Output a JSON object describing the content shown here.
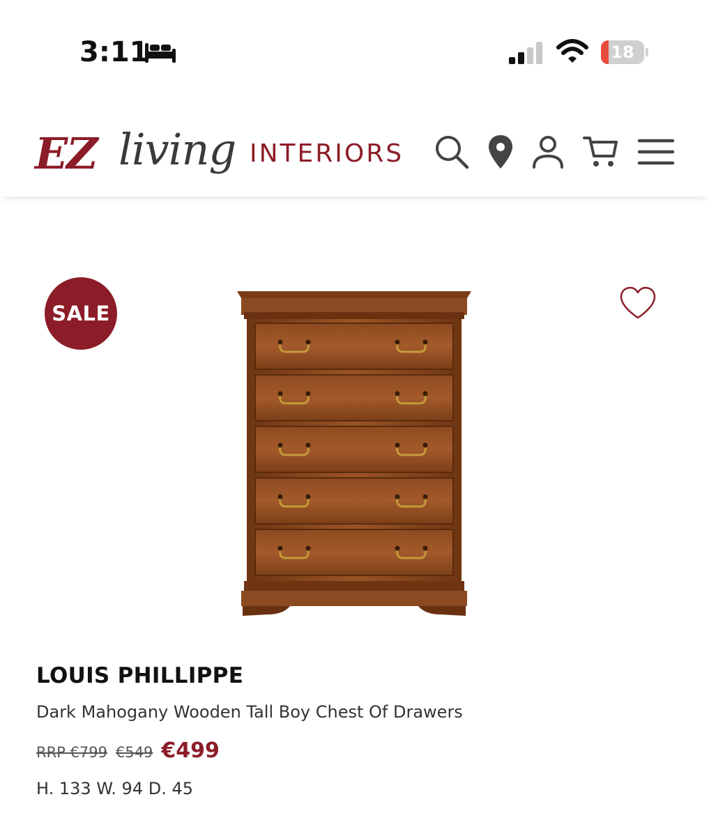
{
  "status_bar": {
    "time": "3:11",
    "battery_level": "18",
    "battery_fraction": 0.18,
    "icons": [
      "bed-icon",
      "signal-icon",
      "wifi-icon",
      "battery-icon"
    ]
  },
  "header": {
    "logo": {
      "part1": "EZ",
      "part2": "living",
      "part3": "INTERIORS"
    },
    "icons": [
      "search-icon",
      "location-icon",
      "user-icon",
      "cart-icon",
      "menu-icon"
    ]
  },
  "product": {
    "badge": "SALE",
    "brand": "LOUIS PHILLIPPE",
    "description": "Dark Mahogany Wooden Tall Boy Chest Of Drawers",
    "price_rrp": "RRP €799",
    "price_was": "€549",
    "price_now": "€499",
    "dimensions": "H. 133 W. 94 D. 45",
    "image_icon": "chest-of-drawers-image",
    "wishlist_icon": "heart-outline-icon"
  },
  "colors": {
    "brand": "#8c1d28",
    "wood": "#8b4a22",
    "battery_low": "#e84a3c"
  }
}
